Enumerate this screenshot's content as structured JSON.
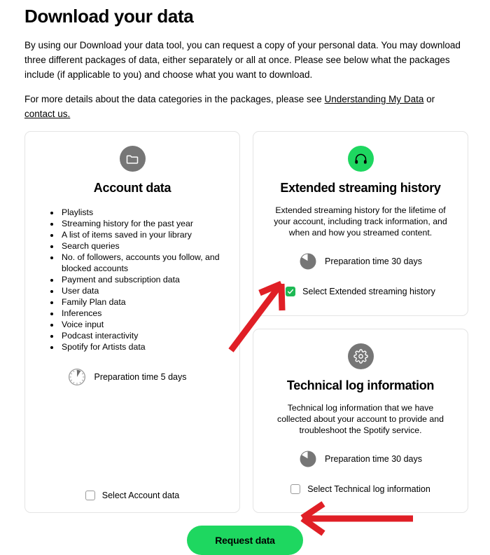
{
  "header": {
    "title": "Download your data",
    "intro_paragraph": "By using our Download your data tool, you can request a copy of your personal data. You may download three different packages of data, either separately or all at once. Please see below what the packages include (if applicable to you) and choose what you want to download.",
    "details_prefix": "For more details about the data categories in the packages, please see ",
    "link_understanding": "Understanding My Data",
    "details_middle": " or ",
    "link_contact": "contact us.",
    "colors": {
      "text": "#000000",
      "link": "#000000"
    }
  },
  "cards": {
    "account_data": {
      "icon": "folder-icon",
      "icon_bg": "#767676",
      "title": "Account data",
      "bullets": [
        "Playlists",
        "Streaming history for the past year",
        "A list of items saved in your library",
        "Search queries",
        "No. of followers, accounts you follow, and blocked accounts",
        "Payment and subscription data",
        "User data",
        "Family Plan data",
        "Inferences",
        "Voice input",
        "Podcast interactivity",
        "Spotify for Artists data"
      ],
      "prep_icon": "clock-5-days-icon",
      "prep_label": "Preparation time 5 days",
      "select_label": "Select Account data",
      "checked": false
    },
    "extended_streaming_history": {
      "icon": "headphones-icon",
      "icon_bg": "#1ed760",
      "title": "Extended streaming history",
      "description": "Extended streaming history for the lifetime of your account, including track information, and when and how you streamed content.",
      "prep_icon": "clock-30-days-icon",
      "prep_label": "Preparation time 30 days",
      "select_label": "Select Extended streaming history",
      "checked": true
    },
    "technical_log_information": {
      "icon": "gear-icon",
      "icon_bg": "#767676",
      "title": "Technical log information",
      "description": "Technical log information that we have collected about your account to provide and troubleshoot the Spotify service.",
      "prep_icon": "clock-30-days-icon",
      "prep_label": "Preparation time 30 days",
      "select_label": "Select Technical log information",
      "checked": false
    }
  },
  "footer": {
    "request_button_label": "Request data",
    "button_color": "#1ed760"
  },
  "annotations": {
    "arrow_color": "#e01f26",
    "arrow_to_extended_checkbox": "red-arrow-pointing-up-right-to-extended-streaming-checkbox",
    "arrow_to_request_button": "red-arrow-pointing-left-to-request-data-button"
  }
}
